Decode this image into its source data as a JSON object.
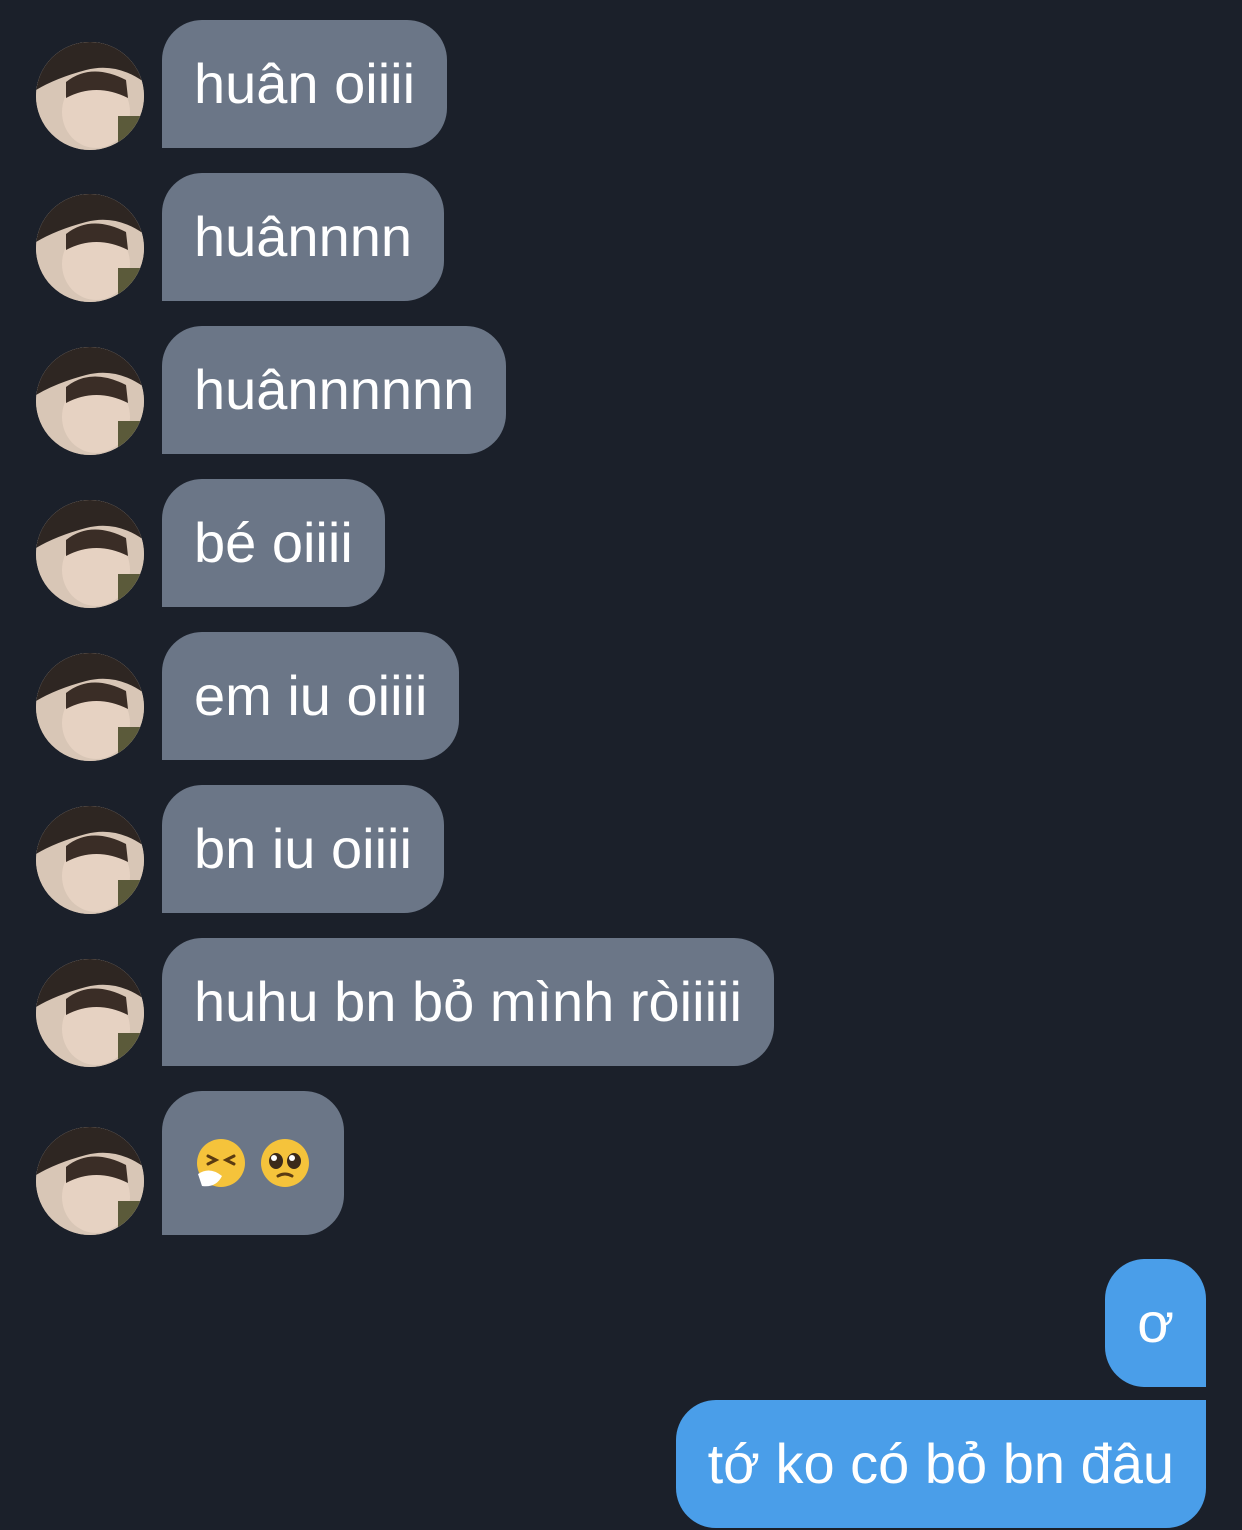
{
  "thread": {
    "incoming": [
      {
        "text": "huân oiiii"
      },
      {
        "text": "huânnnn"
      },
      {
        "text": "huânnnnnn"
      },
      {
        "text": "bé oiiii"
      },
      {
        "text": "em iu oiiii"
      },
      {
        "text": "bn iu oiiii"
      },
      {
        "text": "huhu bn bỏ mình ròiiiii"
      },
      {
        "emojis": [
          "sneezing-face-emoji",
          "pleading-face-emoji"
        ]
      }
    ],
    "outgoing": [
      {
        "text": "ơ"
      },
      {
        "text": "tớ ko có bỏ bn đâu"
      }
    ]
  },
  "colors": {
    "background": "#1b202a",
    "incoming_bubble": "#6b7687",
    "outgoing_bubble": "#4a9ee9",
    "text": "#ffffff"
  }
}
